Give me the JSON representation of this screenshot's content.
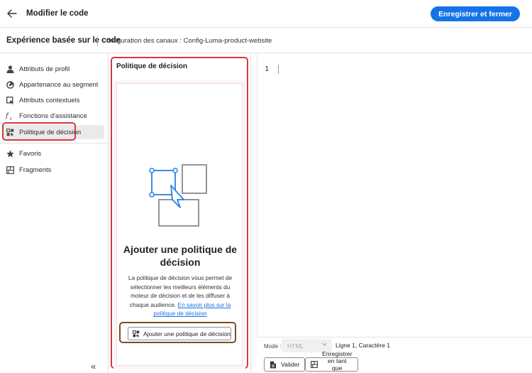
{
  "header": {
    "title": "Modifier le code",
    "primary_button": "Enregistrer et fermer"
  },
  "subheader": {
    "title": "Expérience basée sur le code",
    "config": "Configuration des canaux :  Config-Luma-product-website"
  },
  "sidebar": {
    "items": [
      {
        "label": "Attributs de profil",
        "icon": "user-icon"
      },
      {
        "label": "Appartenance au segment",
        "icon": "segment-icon"
      },
      {
        "label": "Attributs contextuels",
        "icon": "contextual-icon"
      },
      {
        "label": "Fonctions d'assistance",
        "icon": "function-icon"
      },
      {
        "label": "Politique de décision",
        "icon": "decision-policy-icon"
      }
    ],
    "secondary_items": [
      {
        "label": "Favoris",
        "icon": "star-icon"
      },
      {
        "label": "Fragments",
        "icon": "fragments-icon"
      }
    ],
    "collapse": "«"
  },
  "panel": {
    "title": "Politique de décision",
    "card": {
      "heading": "Ajouter une politique de décision",
      "description": "La politique de décision vous permet de sélectionner les meilleurs éléments du moteur de décision et de les diffuser à chaque audience.",
      "link": "En savoir plus sur la politique de décision",
      "button": "Ajouter une politique de décision"
    }
  },
  "editor": {
    "line_number": "1",
    "mode_label": "Mode :",
    "mode_value": "HTML",
    "position": "Ligne 1, Caractère 1",
    "validate_button": "Valider",
    "save_fragment_button": "Enregistrer en tant que fragment"
  },
  "colors": {
    "accent": "#1473e6",
    "highlight_outline": "#d7373f",
    "button_outline": "#7a4e22"
  }
}
